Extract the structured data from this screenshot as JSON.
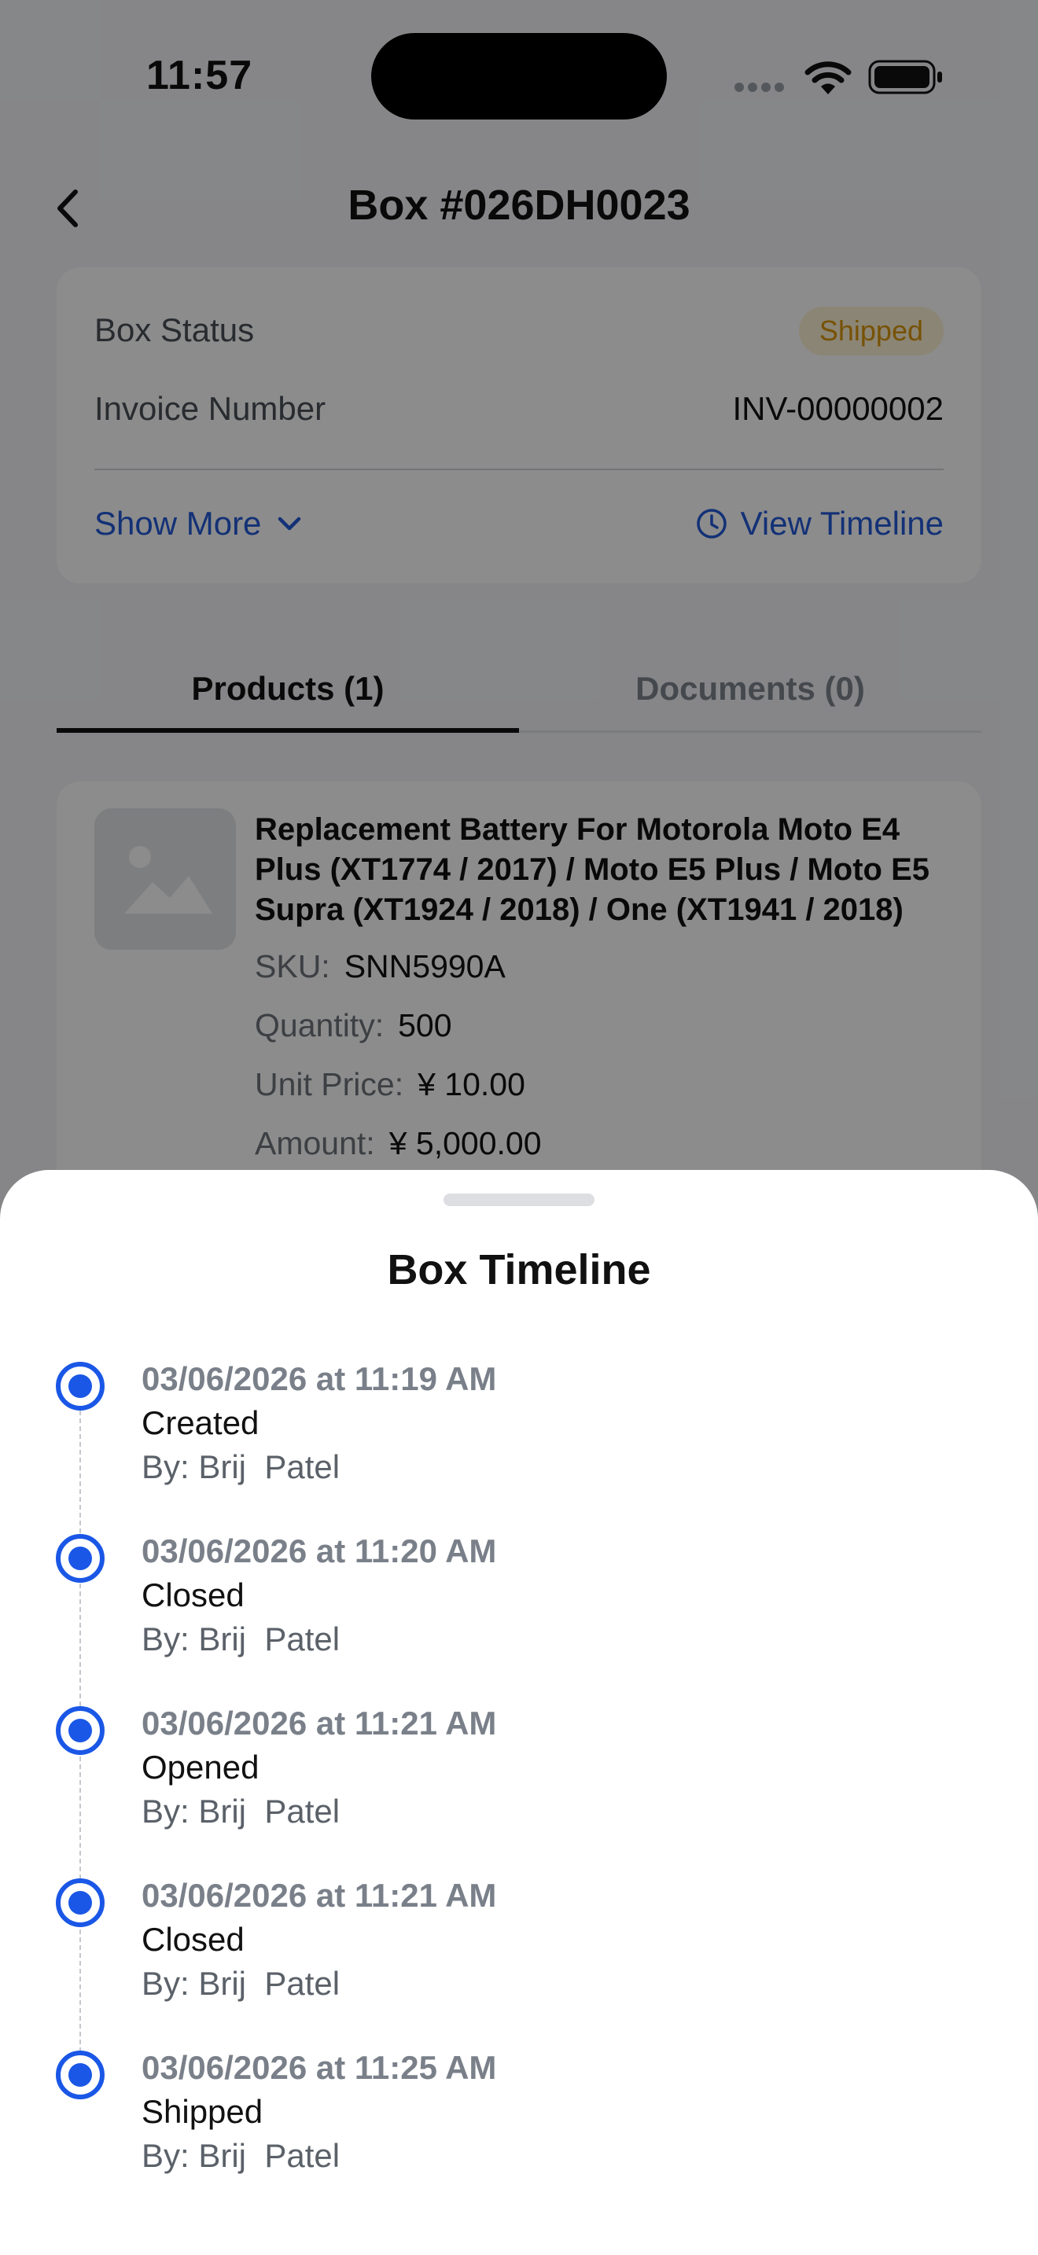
{
  "status_bar": {
    "time": "11:57"
  },
  "nav": {
    "title": "Box #026DH0023"
  },
  "info": {
    "status_label": "Box Status",
    "status_value": "Shipped",
    "invoice_label": "Invoice Number",
    "invoice_value": "INV-00000002",
    "show_more": "Show More",
    "view_timeline": "View Timeline"
  },
  "tabs": [
    {
      "label": "Products (1)",
      "active": true
    },
    {
      "label": "Documents (0)",
      "active": false
    }
  ],
  "product": {
    "name": "Replacement Battery For Motorola Moto E4 Plus (XT1774 / 2017) / Moto E5 Plus / Moto E5 Supra (XT1924 / 2018) / One (XT1941 / 2018)",
    "sku_label": "SKU:",
    "sku_value": "SNN5990A",
    "quantity_label": "Quantity:",
    "quantity_value": "500",
    "unit_price_label": "Unit Price:",
    "unit_price_value": "¥ 10.00",
    "amount_label": "Amount:",
    "amount_value": "¥ 5,000.00"
  },
  "sheet": {
    "title": "Box Timeline",
    "events": [
      {
        "date": "03/06/2026 at 11:19 AM",
        "event": "Created",
        "by": "By: Brij  Patel"
      },
      {
        "date": "03/06/2026 at 11:20 AM",
        "event": "Closed",
        "by": "By: Brij  Patel"
      },
      {
        "date": "03/06/2026 at 11:21 AM",
        "event": "Opened",
        "by": "By: Brij  Patel"
      },
      {
        "date": "03/06/2026 at 11:21 AM",
        "event": "Closed",
        "by": "By: Brij  Patel"
      },
      {
        "date": "03/06/2026 at 11:25 AM",
        "event": "Shipped",
        "by": "By: Brij  Patel"
      }
    ]
  },
  "colors": {
    "accent": "#1a57e6",
    "link": "#2359d8",
    "badge_bg": "#fdf2d6",
    "badge_text": "#d9950a"
  }
}
